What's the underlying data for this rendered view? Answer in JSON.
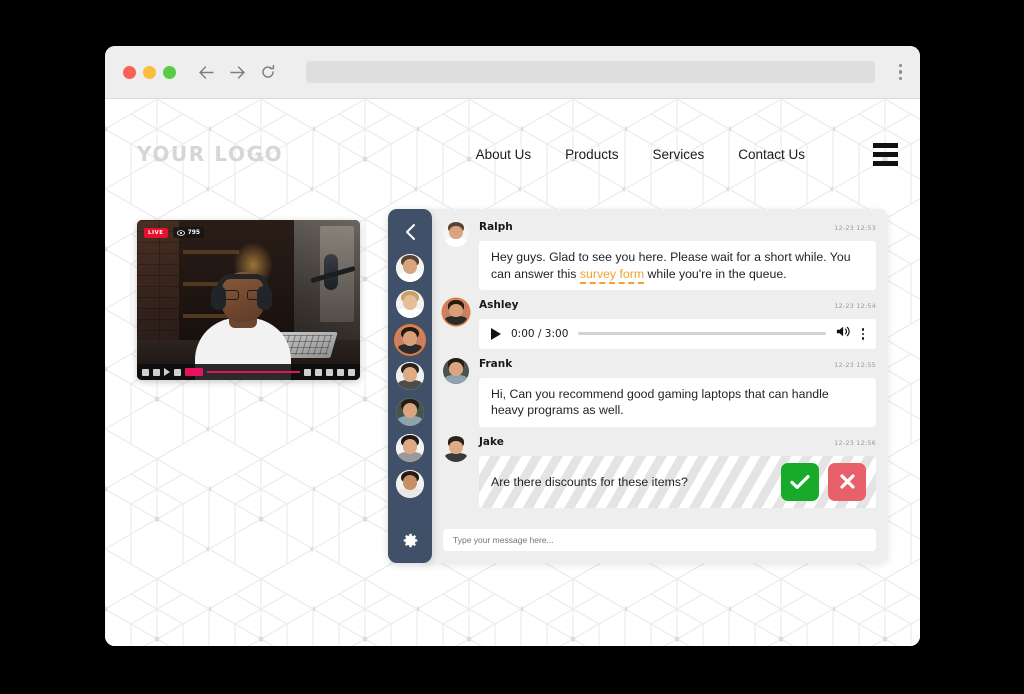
{
  "browser": {
    "traffic_lights": [
      "close",
      "minimize",
      "maximize"
    ],
    "back_icon": "arrow-left-icon",
    "forward_icon": "arrow-right-icon",
    "reload_icon": "reload-icon",
    "url_value": "",
    "menu_icon": "kebab-menu-icon"
  },
  "site_header": {
    "logo": "YOUR LOGO",
    "nav": [
      {
        "label": "About Us"
      },
      {
        "label": "Products"
      },
      {
        "label": "Services"
      },
      {
        "label": "Contact Us"
      }
    ],
    "hamburger_icon": "hamburger-menu-icon"
  },
  "video": {
    "live_label": "LIVE",
    "viewers": "795",
    "viewers_icon": "eye-icon",
    "controls": {
      "prev_icon": "skip-previous-icon",
      "rewind_icon": "rewind-icon",
      "play_icon": "play-icon",
      "forward_icon": "fast-forward-icon",
      "time_chip": "00:00",
      "cc_icon": "closed-captions-icon",
      "quality_icon": "hd-icon",
      "fullscreen_icon": "fullscreen-icon",
      "pip_icon": "picture-in-picture-icon",
      "volume_icon": "volume-icon"
    }
  },
  "chat": {
    "rail": {
      "back_icon": "chevron-left-icon",
      "settings_icon": "gear-icon",
      "participants": [
        {
          "name": "participant-1",
          "active": false
        },
        {
          "name": "participant-2",
          "active": false
        },
        {
          "name": "participant-3",
          "active": true
        },
        {
          "name": "participant-4",
          "active": false
        },
        {
          "name": "participant-5",
          "active": false
        },
        {
          "name": "participant-6",
          "active": false
        },
        {
          "name": "participant-7",
          "active": false
        }
      ]
    },
    "messages": [
      {
        "type": "text",
        "author": "Ralph",
        "time": "12-23 12:53",
        "text_before": "Hey guys. Glad to see you here. Please wait for a short while. You can answer this ",
        "link": "survey form",
        "text_after": " while you're in the queue."
      },
      {
        "type": "audio",
        "author": "Ashley",
        "time": "12-23 12:54",
        "play_icon": "play-icon",
        "duration": "0:00 / 3:00",
        "volume_icon": "volume-icon",
        "more_icon": "kebab-menu-icon",
        "progress_percent": 0
      },
      {
        "type": "text",
        "author": "Frank",
        "time": "12-23 12:55",
        "text": "Hi, Can you recommend good gaming laptops that can handle heavy programs as well."
      },
      {
        "type": "pending",
        "author": "Jake",
        "time": "12-23 12:56",
        "text": "Are there discounts for these items?",
        "approve_icon": "check-icon",
        "reject_icon": "close-icon"
      }
    ],
    "input": {
      "placeholder": "Type your message here...",
      "value": ""
    }
  },
  "colors": {
    "rail": "#415069",
    "panel": "#eeeeee",
    "link": "#f5a02a",
    "approve": "#18ab29",
    "reject": "#e8616a",
    "live": "#e8112d"
  }
}
